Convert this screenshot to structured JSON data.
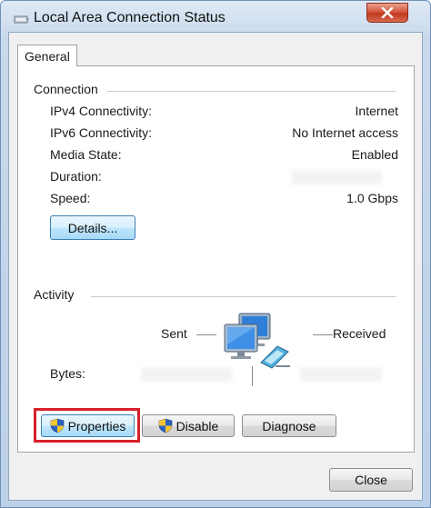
{
  "window": {
    "title": "Local Area Connection Status"
  },
  "tabs": [
    {
      "label": "General"
    }
  ],
  "connection": {
    "heading": "Connection",
    "rows": [
      {
        "label": "IPv4 Connectivity:",
        "value": "Internet"
      },
      {
        "label": "IPv6 Connectivity:",
        "value": "No Internet access"
      },
      {
        "label": "Media State:",
        "value": "Enabled"
      },
      {
        "label": "Duration:",
        "value": ""
      },
      {
        "label": "Speed:",
        "value": "1.0 Gbps"
      }
    ],
    "details_button": "Details..."
  },
  "activity": {
    "heading": "Activity",
    "sent_label": "Sent",
    "received_label": "Received",
    "bytes_label": "Bytes:"
  },
  "buttons": {
    "properties": "Properties",
    "disable": "Disable",
    "diagnose": "Diagnose",
    "close": "Close"
  },
  "colors": {
    "highlight": "#d6202a",
    "focus_border": "#3c7fb1"
  },
  "icons": {
    "title": "network-status-icon",
    "close": "close-icon",
    "activity": "network-computers-icon",
    "shield": "uac-shield-icon"
  }
}
